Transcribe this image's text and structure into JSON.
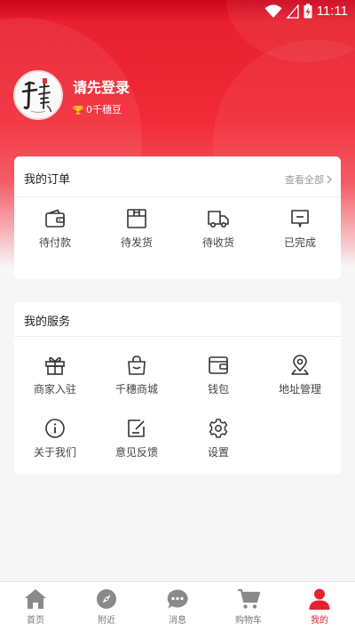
{
  "status_bar": {
    "time": "11:11"
  },
  "profile": {
    "login_prompt": "请先登录",
    "points": "0千穗豆",
    "avatar_label": "千穗"
  },
  "orders": {
    "title": "我的订单",
    "view_all": "查看全部",
    "items": [
      {
        "label": "待付款",
        "icon": "wallet-icon"
      },
      {
        "label": "待发货",
        "icon": "package-icon"
      },
      {
        "label": "待收货",
        "icon": "truck-icon"
      },
      {
        "label": "已完成",
        "icon": "message-icon"
      }
    ]
  },
  "services": {
    "title": "我的服务",
    "items": [
      {
        "label": "商家入驻",
        "icon": "gift-icon"
      },
      {
        "label": "千穗商城",
        "icon": "shopping-bag-icon"
      },
      {
        "label": "钱包",
        "icon": "wallet-icon"
      },
      {
        "label": "地址管理",
        "icon": "location-pin-icon"
      },
      {
        "label": "关于我们",
        "icon": "info-icon"
      },
      {
        "label": "意见反馈",
        "icon": "edit-icon"
      },
      {
        "label": "设置",
        "icon": "gear-icon"
      }
    ]
  },
  "tabbar": {
    "items": [
      {
        "label": "首页",
        "icon": "home-icon"
      },
      {
        "label": "附近",
        "icon": "compass-icon"
      },
      {
        "label": "消息",
        "icon": "chat-icon"
      },
      {
        "label": "购物车",
        "icon": "cart-icon"
      },
      {
        "label": "我的",
        "icon": "user-icon"
      }
    ],
    "active": "我的"
  },
  "colors": {
    "accent": "#e8202f",
    "background": "#f6f6f6",
    "inactive_tab": "#777777"
  }
}
